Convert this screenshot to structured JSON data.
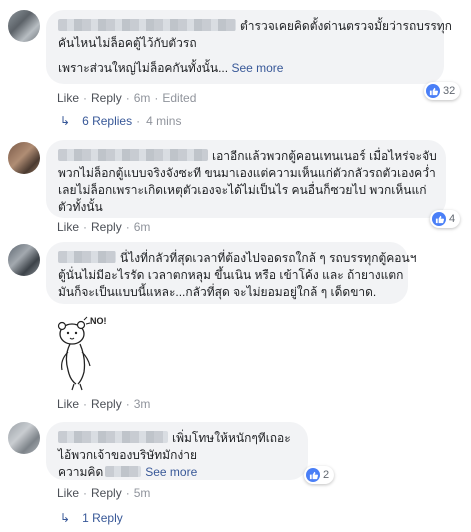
{
  "comments": [
    {
      "lines": [
        "ตำรวจเคยคิดตั้งด่านตรวจมั้ยว่ารถบรรทุก",
        "คันไหนไม่ล็อคตู้ไว้กับตัวรถ",
        "เพราะส่วนใหญ่ไม่ล็อคกันทั้งนั้น..."
      ],
      "see_more": "See more",
      "like": "Like",
      "reply": "Reply",
      "time": "6m",
      "edited": "Edited",
      "reactions": "32",
      "replies": {
        "label": "6 Replies",
        "time": "4 mins"
      }
    },
    {
      "lines": [
        "เอาอีกแล้วพวกตู้คอนเทนเนอร์ เมื่อไหร่จะจับ",
        "พวกไม่ล็อกตู้แบบจริงจังซะที ขนมาเองแต่ความเห็นแก่ตัวกลัวรถตัวเองคว่ำ",
        "เลยไม่ล็อกเพราะเกิดเหตุตัวเองจะได้ไม่เป็นไร คนอื่นก็ซวยไป พวกเห็นแก่",
        "ตัวทั้งนั้น"
      ],
      "like": "Like",
      "reply": "Reply",
      "time": "6m",
      "reactions": "4"
    },
    {
      "lines": [
        "นี่ไงที่กลัวที่สุดเวลาที่ต้องไปจอดรถใกล้ ๆ รถบรรทุกตู้คอนฯ",
        "ตู้นั่นไม่มีอะไรรัด เวลาตกหลุม ขึ้นเนิน หรือ เข้าโค้ง และ ถ้ายางแตก",
        "มันก็จะเป็นแบบนี้แหละ...กลัวที่สุด จะไม่ยอมอยู่ใกล้ ๆ เด็ดขาด."
      ],
      "sticker_text": "NO!",
      "like": "Like",
      "reply": "Reply",
      "time": "3m"
    },
    {
      "lines": [
        "เพิ่มโทษให้หนักๆทีเถอะ",
        "ไอ้พวกเจ้าของบริษัทมักง่าย",
        "ความคิด"
      ],
      "see_more": "See more",
      "like": "Like",
      "reply": "Reply",
      "time": "5m",
      "reactions": "2",
      "replies": {
        "label": "1 Reply"
      }
    }
  ],
  "colors": {
    "link": "#385898",
    "bubble": "#f2f3f5",
    "like_blue": "#4a7ff7",
    "meta": "#90949c"
  },
  "icons": [
    "like-thumb-icon",
    "reply-arrow-icon",
    "no-sticker-icon"
  ]
}
